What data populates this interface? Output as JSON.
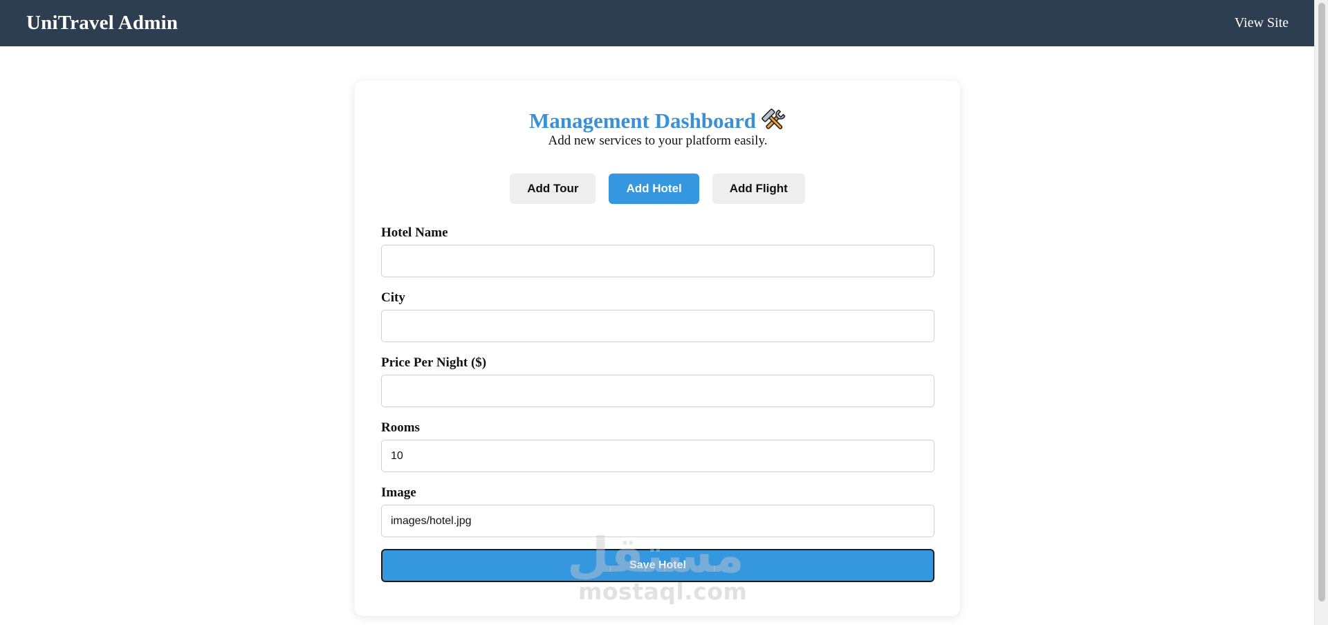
{
  "topbar": {
    "brand": "UniTravel Admin",
    "view_site": "View Site",
    "bg_color": "#2e3e51"
  },
  "header": {
    "title": "Management Dashboard",
    "title_icon": "hammer-and-wrench-icon",
    "subtitle": "Add new services to your platform easily."
  },
  "tabs": [
    {
      "label": "Add Tour",
      "active": false
    },
    {
      "label": "Add Hotel",
      "active": true
    },
    {
      "label": "Add Flight",
      "active": false
    }
  ],
  "form": {
    "fields": [
      {
        "label": "Hotel Name",
        "value": ""
      },
      {
        "label": "City",
        "value": ""
      },
      {
        "label": "Price Per Night ($)",
        "value": ""
      },
      {
        "label": "Rooms",
        "value": "10"
      },
      {
        "label": "Image",
        "value": "images/hotel.jpg"
      }
    ],
    "submit_label": "Save Hotel"
  },
  "watermark": {
    "arabic": "مستقل",
    "latin": "mostaql.com"
  },
  "colors": {
    "accent": "#3597e0",
    "title": "#3a8fd6"
  }
}
